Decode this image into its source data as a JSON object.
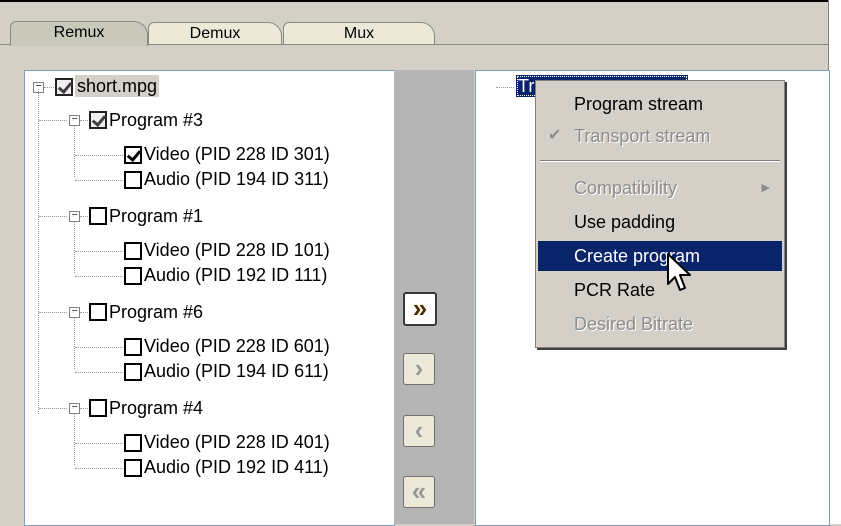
{
  "tabs": {
    "remux": "Remux",
    "demux": "Demux",
    "mux": "Mux"
  },
  "tree": {
    "root": "short.mpg",
    "programs": [
      {
        "label": "Program #3",
        "children": [
          "Video (PID 228 ID 301)",
          "Audio (PID 194 ID 311)"
        ]
      },
      {
        "label": "Program #1",
        "children": [
          "Video (PID 228 ID 101)",
          "Audio (PID 192 ID 111)"
        ]
      },
      {
        "label": "Program #6",
        "children": [
          "Video (PID 228 ID 601)",
          "Audio (PID 194 ID 611)"
        ]
      },
      {
        "label": "Program #4",
        "children": [
          "Video (PID 228 ID 401)",
          "Audio (PID 192 ID 411)"
        ]
      }
    ]
  },
  "arrows": {
    "move_all_right": "»",
    "move_right": "›",
    "move_left": "‹",
    "move_all_left": "«"
  },
  "output": {
    "node_label": "Tr"
  },
  "context_menu": {
    "items": [
      {
        "label": "Program stream",
        "enabled": true
      },
      {
        "label": "Transport stream",
        "enabled": false,
        "checked": true
      },
      {
        "label": "Compatibility",
        "enabled": false,
        "submenu": true
      },
      {
        "label": "Use padding",
        "enabled": true
      },
      {
        "label": "Create program",
        "enabled": true,
        "highlighted": true
      },
      {
        "label": "PCR Rate",
        "enabled": true
      },
      {
        "label": "Desired Bitrate",
        "enabled": false
      }
    ]
  },
  "icons": {
    "checkmark": "check-icon",
    "submenu_arrow": "chevron-right-icon",
    "cursor": "mouse-pointer-icon"
  },
  "colors": {
    "selection": "#0a246a",
    "face": "#d4d0c8",
    "disabled_text": "#8d8d8d"
  }
}
